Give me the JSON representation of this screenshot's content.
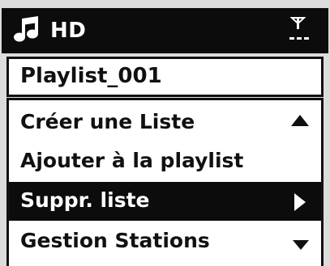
{
  "header": {
    "source_label": "HD",
    "source_icon": "music-note-icon",
    "signal_icon": "antenna-signal-icon"
  },
  "title": {
    "text": "Playlist_001"
  },
  "menu": {
    "items": [
      {
        "label": "Créer une Liste",
        "selected": false
      },
      {
        "label": "Ajouter à la playlist",
        "selected": false
      },
      {
        "label": "Suppr. liste",
        "selected": true
      },
      {
        "label": "Gestion Stations",
        "selected": false
      }
    ],
    "scroll_up_icon": "triangle-up-icon",
    "scroll_down_icon": "triangle-down-icon",
    "submenu_icon": "triangle-right-icon"
  },
  "colors": {
    "background": "#dcdcdc",
    "bar": "#0c0c0c",
    "panel": "#ffffff",
    "text": "#111111",
    "selected_text": "#ffffff"
  }
}
